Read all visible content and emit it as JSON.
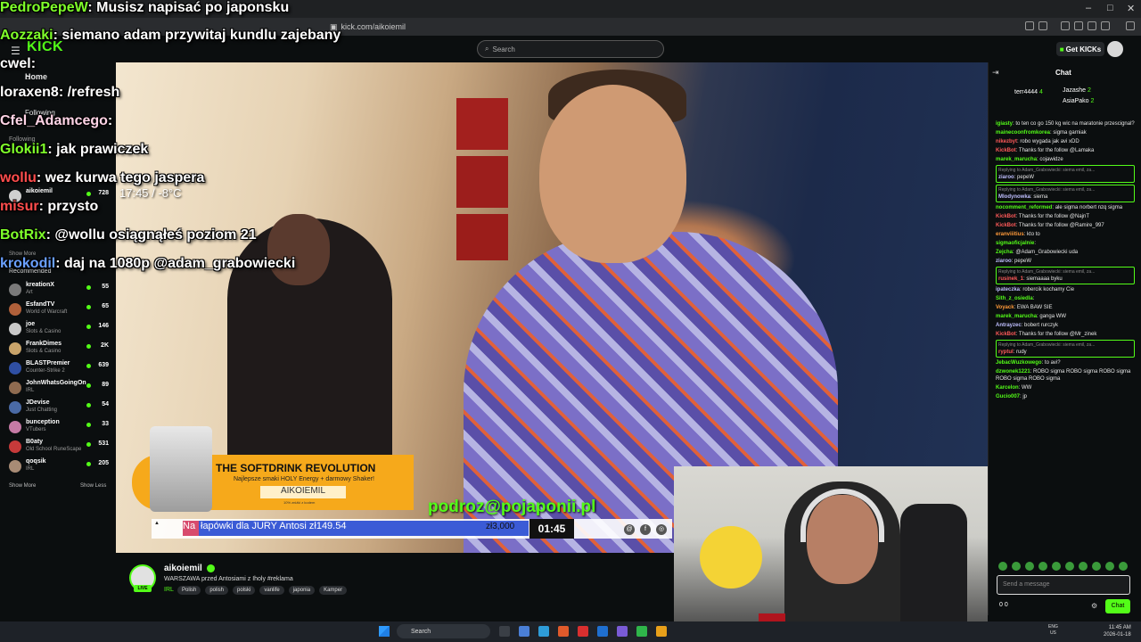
{
  "browser": {
    "url": "kick.com/aikoiemil"
  },
  "header": {
    "logo": "KICK",
    "search_placeholder": "Search",
    "get_kicks": "Get KICKs"
  },
  "sidebar": {
    "home": "Home",
    "following": "Following",
    "following_section": "Following",
    "following_active": {
      "name": "aikoiemil",
      "count": "728"
    },
    "show_more_following": "Show More",
    "recommended": "Recommended",
    "items": [
      {
        "name": "kreationX",
        "category": "Art",
        "count": "55",
        "color": "#7a7a7a"
      },
      {
        "name": "EsfandTV",
        "category": "World of Warcraft",
        "count": "65",
        "color": "#b0603a"
      },
      {
        "name": "joe",
        "category": "Slots & Casino",
        "count": "146",
        "color": "#c8c8c8"
      },
      {
        "name": "FrankDimes",
        "category": "Slots & Casino",
        "count": "2K",
        "color": "#c9a46a"
      },
      {
        "name": "BLASTPremier",
        "category": "Counter-Strike 2",
        "count": "639",
        "color": "#2f4fa3"
      },
      {
        "name": "JohnWhatsGoingOn",
        "category": "IRL",
        "count": "89",
        "color": "#8f6b50"
      },
      {
        "name": "JDevise",
        "category": "Just Chatting",
        "count": "54",
        "color": "#4a6aa5"
      },
      {
        "name": "bunception",
        "category": "VTubers",
        "count": "33",
        "color": "#c57aa5"
      },
      {
        "name": "B0aty",
        "category": "Old School RuneScape",
        "count": "531",
        "color": "#c63a3a"
      },
      {
        "name": "qoqsik",
        "category": "IRL",
        "count": "205",
        "color": "#a88b75"
      }
    ],
    "show_more": "Show More",
    "show_less": "Show Less"
  },
  "overlay_chat": [
    {
      "user": "PedroPepeW",
      "user_color": "#7fff2a",
      "text": ": Musisz napisać po japonsku"
    },
    {
      "user": "Aozzaki",
      "user_color": "#7fff2a",
      "text": ": siemano adam przywitaj kundlu zajebany"
    },
    {
      "user": "cwel",
      "user_color": "#ffffff",
      "text": ":"
    },
    {
      "user": "loraxen8",
      "user_color": "#ffffff",
      "text": ": /refresh"
    },
    {
      "user": "Cfel_Adamcego",
      "user_color": "#ffd4e6",
      "text": ":"
    },
    {
      "user": "Glokii1",
      "user_color": "#7fff2a",
      "text": ": jak prawiczek"
    },
    {
      "user": "wollu",
      "user_color": "#ff4d4d",
      "text": ": wez kurwa tego jaspera"
    },
    {
      "user": "misur",
      "user_color": "#ff4d4d",
      "text": ": przysto"
    },
    {
      "user": "BotRix",
      "user_color": "#7fff2a",
      "text": ": @wollu osiągnąłeś poziom 21"
    },
    {
      "user": "krokodil",
      "user_color": "#6aa0ff",
      "text": ": daj na 1080p @adam_grabowiecki"
    }
  ],
  "overlay_clock": "17:45 / -8°C",
  "video": {
    "promo_title": "THE SOFTDRINK REVOLUTION",
    "promo_sub": "Najlepsze smaki HOLY Energy + darmowy Shaker!",
    "promo_code": "AIKOIEMIL",
    "promo_small": "10% zniżki z kodem",
    "email": "podroz@pojaponii.pl",
    "ticker_label": "Na",
    "ticker_text": "łapówki dla JURY Antosi     zł149.54",
    "ticker_amount": "zł3,000",
    "ticker_time": "01:45"
  },
  "stream": {
    "name": "aikoiemil",
    "title": "WARSZAWA przed Antosiami z Iholy #reklama",
    "category": "IRL",
    "tags": [
      "Polish",
      "polish",
      "polski",
      "vanlife",
      "japonia",
      "Kamper"
    ],
    "live": "LIVE"
  },
  "chat": {
    "title": "Chat",
    "leaderboard": [
      {
        "name": "terr4444",
        "count": "4"
      },
      {
        "name": "Jazashe",
        "count": "2"
      },
      {
        "name": "AsiaPako",
        "count": "2"
      }
    ],
    "messages": [
      {
        "user": "igiasty",
        "color": "#53fc18",
        "text": ": to ten co go 150 kg wic na maratonie przescignal?",
        "reply": ""
      },
      {
        "user": "mainecoonfromkorea",
        "color": "#53fc18",
        "text": ": sigma garniak",
        "reply": ""
      },
      {
        "user": "nikezbyt",
        "color": "#ff5a5a",
        "text": ": robo wygada jak avi xDD",
        "reply": ""
      },
      {
        "user": "KickBot",
        "color": "#ff5a5a",
        "text": ": Thanks for the follow @Lamaka",
        "reply": ""
      },
      {
        "user": "marek_marucha",
        "color": "#53fc18",
        "text": ": cojawidze",
        "reply": ""
      },
      {
        "user": "ziaroo",
        "color": "#bfbfff",
        "text": ": pepeW",
        "reply": "Replying to Adam_Grabowiecki: siema emil, za..."
      },
      {
        "user": "Mlodynowka",
        "color": "#bfbfff",
        "text": ": siema",
        "reply": "Replying to Adam_Grabowiecki: siema emil, za..."
      },
      {
        "user": "nocomment_reformed",
        "color": "#53fc18",
        "text": ": ale sigma norbert nzq sigma",
        "reply": ""
      },
      {
        "user": "KickBot",
        "color": "#ff5a5a",
        "text": ": Thanks for the follow @NajnT",
        "reply": ""
      },
      {
        "user": "KickBot",
        "color": "#ff5a5a",
        "text": ": Thanks for the follow @Ramire_997",
        "reply": ""
      },
      {
        "user": "eranviiitius",
        "color": "#ff9a3a",
        "text": ": kto to",
        "reply": ""
      },
      {
        "user": "sigmaoficjalnie",
        "color": "#53fc18",
        "text": ":",
        "reply": ""
      },
      {
        "user": "Zejcha",
        "color": "#53fc18",
        "text": ": @Adam_Grabowiecki uda",
        "reply": ""
      },
      {
        "user": "ziaroo",
        "color": "#bfbfff",
        "text": ": pepeW",
        "reply": ""
      },
      {
        "user": "rusinek_1",
        "color": "#ff5a5a",
        "text": ": siemaaaa byku",
        "reply": "Replying to Adam_Grabowiecki: siema emil, za..."
      },
      {
        "user": "ipateczka",
        "color": "#bfbfff",
        "text": ": robercik kochamy Cie",
        "reply": ""
      },
      {
        "user": "Sith_z_osiedla",
        "color": "#53fc18",
        "text": ":",
        "reply": ""
      },
      {
        "user": "Voyack",
        "color": "#ff9a3a",
        "text": ": EWA BAW SIE",
        "reply": ""
      },
      {
        "user": "marek_marucha",
        "color": "#53fc18",
        "text": ": ganga WW",
        "reply": ""
      },
      {
        "user": "Antrayzec",
        "color": "#bfbfff",
        "text": ": bobert rurczyk",
        "reply": ""
      },
      {
        "user": "KickBot",
        "color": "#ff5a5a",
        "text": ": Thanks for the follow @Mr_zinek",
        "reply": ""
      },
      {
        "user": "ryptul",
        "color": "#ff5a5a",
        "text": ": rudy",
        "reply": "Replying to Adam_Grabowiecki: siema emil, za..."
      },
      {
        "user": "JebacWuzkowego",
        "color": "#53fc18",
        "text": ": to avi?",
        "reply": ""
      },
      {
        "user": "dzwonek1221",
        "color": "#53fc18",
        "text": ": ROBO sigma ROBO sigma ROBO sigma ROBO sigma ROBO sigma",
        "reply": ""
      },
      {
        "user": "Karcelon",
        "color": "#53fc18",
        "text": ": WW",
        "reply": ""
      },
      {
        "user": "Gucio007",
        "color": "#53fc18",
        "text": ": jp",
        "reply": ""
      }
    ],
    "input_placeholder": "Send a message",
    "footer_counts": "0     0",
    "send": "Chat"
  },
  "taskbar": {
    "search": "Search",
    "lang": "ENG\nUS",
    "time": "11:45 AM",
    "date": "2026-01-18"
  }
}
